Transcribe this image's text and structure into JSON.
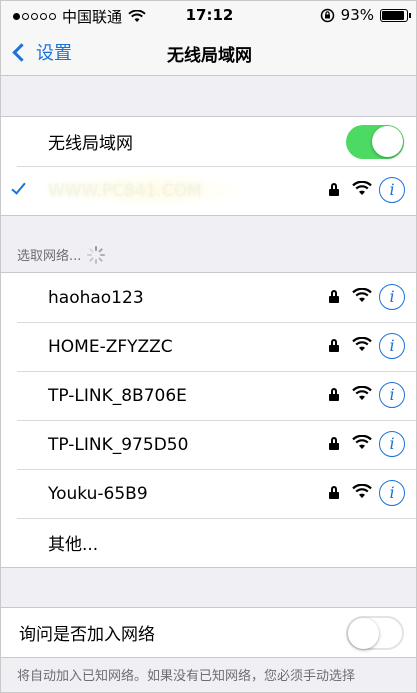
{
  "status_bar": {
    "carrier": "中国联通",
    "time": "17:12",
    "battery": "93%",
    "battery_level": 0.93
  },
  "nav": {
    "back_label": "设置",
    "title": "无线局域网"
  },
  "wifi_toggle": {
    "label": "无线局域网",
    "on": true
  },
  "connected": {
    "ssid": "WWW.PC841.COM"
  },
  "choose_header": "选取网络...",
  "networks": [
    {
      "name": "haohao123"
    },
    {
      "name": "HOME-ZFYZZC"
    },
    {
      "name": "TP-LINK_8B706E"
    },
    {
      "name": "TP-LINK_975D50"
    },
    {
      "name": "Youku-65B9"
    }
  ],
  "other_label": "其他...",
  "ask_join": {
    "label": "询问是否加入网络",
    "on": false
  },
  "footer": "将自动加入已知网络。如果没有已知网络，您必须手动选择",
  "colors": {
    "accent": "#1a73d9",
    "toggle_on": "#4cd964",
    "background": "#efeff4"
  }
}
